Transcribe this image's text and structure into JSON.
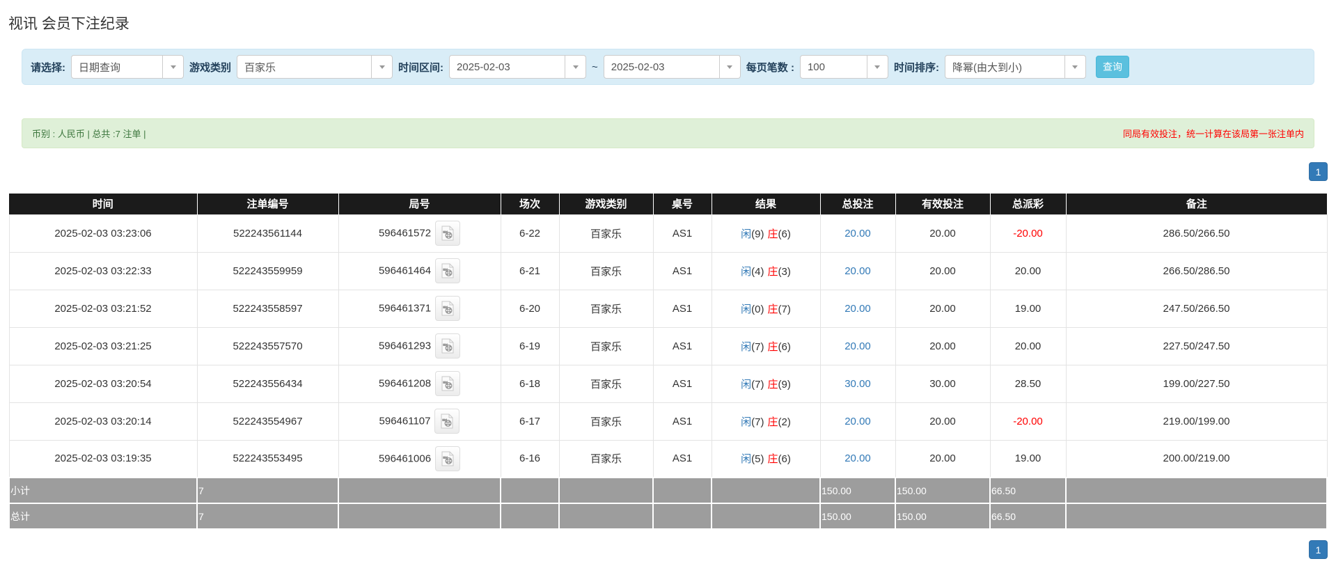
{
  "page_title": "视讯 会员下注纪录",
  "filters": {
    "select_label": "请选择:",
    "select_value": "日期查询",
    "game_type_label": "游戏类别",
    "game_type_value": "百家乐",
    "time_range_label": "时间区间:",
    "date_from": "2025-02-03",
    "date_separator": "~",
    "date_to": "2025-02-03",
    "page_size_label": "每页笔数 :",
    "page_size_value": "100",
    "sort_label": "时间排序:",
    "sort_value": "降幂(由大到小)",
    "search_button": "查询"
  },
  "summary": {
    "left_text": "币别 : 人民币 | 总共 :7 注单 |",
    "right_notice": "同局有效投注，统一计算在该局第一张注单内"
  },
  "pagination": {
    "page": "1"
  },
  "icons": {
    "dropdown": "chevron-down",
    "round_video": "film-reel-document"
  },
  "colors": {
    "filter_bg": "#d9edf7",
    "summary_bg": "#dff0d8",
    "header_bg": "#1b1b1b",
    "accent_blue": "#337ab7",
    "negative_red": "#ff0000",
    "search_btn": "#5bc0de",
    "subtotal_bg": "#9d9d9d"
  },
  "table": {
    "headers": [
      "时间",
      "注单编号",
      "局号",
      "场次",
      "游戏类别",
      "桌号",
      "结果",
      "总投注",
      "有效投注",
      "总派彩",
      "备注"
    ],
    "rows": [
      {
        "time": "2025-02-03 03:23:06",
        "bet_id": "522243561144",
        "round_id": "596461572",
        "session": "6-22",
        "game": "百家乐",
        "table_id": "AS1",
        "player_label": "闲",
        "player_score": "(9)",
        "banker_label": "庄",
        "banker_score": "(6)",
        "total_bet": "20.00",
        "valid_bet": "20.00",
        "payout": "-20.00",
        "note": "286.50/266.50"
      },
      {
        "time": "2025-02-03 03:22:33",
        "bet_id": "522243559959",
        "round_id": "596461464",
        "session": "6-21",
        "game": "百家乐",
        "table_id": "AS1",
        "player_label": "闲",
        "player_score": "(4)",
        "banker_label": "庄",
        "banker_score": "(3)",
        "total_bet": "20.00",
        "valid_bet": "20.00",
        "payout": "20.00",
        "note": "266.50/286.50"
      },
      {
        "time": "2025-02-03 03:21:52",
        "bet_id": "522243558597",
        "round_id": "596461371",
        "session": "6-20",
        "game": "百家乐",
        "table_id": "AS1",
        "player_label": "闲",
        "player_score": "(0)",
        "banker_label": "庄",
        "banker_score": "(7)",
        "total_bet": "20.00",
        "valid_bet": "20.00",
        "payout": "19.00",
        "note": "247.50/266.50"
      },
      {
        "time": "2025-02-03 03:21:25",
        "bet_id": "522243557570",
        "round_id": "596461293",
        "session": "6-19",
        "game": "百家乐",
        "table_id": "AS1",
        "player_label": "闲",
        "player_score": "(7)",
        "banker_label": "庄",
        "banker_score": "(6)",
        "total_bet": "20.00",
        "valid_bet": "20.00",
        "payout": "20.00",
        "note": "227.50/247.50"
      },
      {
        "time": "2025-02-03 03:20:54",
        "bet_id": "522243556434",
        "round_id": "596461208",
        "session": "6-18",
        "game": "百家乐",
        "table_id": "AS1",
        "player_label": "闲",
        "player_score": "(7)",
        "banker_label": "庄",
        "banker_score": "(9)",
        "total_bet": "30.00",
        "valid_bet": "30.00",
        "payout": "28.50",
        "note": "199.00/227.50"
      },
      {
        "time": "2025-02-03 03:20:14",
        "bet_id": "522243554967",
        "round_id": "596461107",
        "session": "6-17",
        "game": "百家乐",
        "table_id": "AS1",
        "player_label": "闲",
        "player_score": "(7)",
        "banker_label": "庄",
        "banker_score": "(2)",
        "total_bet": "20.00",
        "valid_bet": "20.00",
        "payout": "-20.00",
        "note": "219.00/199.00"
      },
      {
        "time": "2025-02-03 03:19:35",
        "bet_id": "522243553495",
        "round_id": "596461006",
        "session": "6-16",
        "game": "百家乐",
        "table_id": "AS1",
        "player_label": "闲",
        "player_score": "(5)",
        "banker_label": "庄",
        "banker_score": "(6)",
        "total_bet": "20.00",
        "valid_bet": "20.00",
        "payout": "19.00",
        "note": "200.00/219.00"
      }
    ],
    "subtotal": {
      "label": "小计",
      "count": "7",
      "total_bet": "150.00",
      "valid_bet": "150.00",
      "payout": "66.50"
    },
    "total": {
      "label": "总计",
      "count": "7",
      "total_bet": "150.00",
      "valid_bet": "150.00",
      "payout": "66.50"
    }
  }
}
